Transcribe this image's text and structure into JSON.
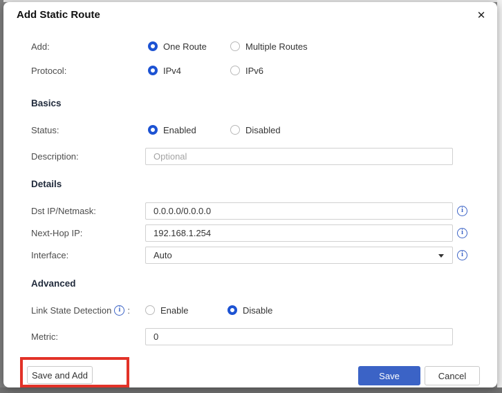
{
  "dialog": {
    "title": "Add Static Route"
  },
  "icons": {
    "close": "✕",
    "info": "i"
  },
  "form": {
    "add": {
      "label": "Add:",
      "options": [
        {
          "label": "One Route",
          "selected": true
        },
        {
          "label": "Multiple Routes",
          "selected": false
        }
      ]
    },
    "protocol": {
      "label": "Protocol:",
      "options": [
        {
          "label": "IPv4",
          "selected": true
        },
        {
          "label": "IPv6",
          "selected": false
        }
      ]
    },
    "sections": {
      "basics": "Basics",
      "details": "Details",
      "advanced": "Advanced"
    },
    "status": {
      "label": "Status:",
      "options": [
        {
          "label": "Enabled",
          "selected": true
        },
        {
          "label": "Disabled",
          "selected": false
        }
      ]
    },
    "description": {
      "label": "Description:",
      "placeholder": "Optional",
      "value": ""
    },
    "dst_ip": {
      "label": "Dst IP/Netmask:",
      "value": "0.0.0.0/0.0.0.0"
    },
    "next_hop": {
      "label": "Next-Hop IP:",
      "value": "192.168.1.254"
    },
    "interface": {
      "label": "Interface:",
      "value": "Auto"
    },
    "link_state": {
      "label": "Link State Detection",
      "suffix": ":",
      "options": [
        {
          "label": "Enable",
          "selected": false
        },
        {
          "label": "Disable",
          "selected": true
        }
      ]
    },
    "metric": {
      "label": "Metric:",
      "value": "0"
    }
  },
  "buttons": {
    "save_and_add": "Save and Add",
    "save": "Save",
    "cancel": "Cancel"
  },
  "colors": {
    "primary_blue": "#3b63c6",
    "radio_blue": "#1d53d3",
    "annotation_red": "#e23228"
  }
}
